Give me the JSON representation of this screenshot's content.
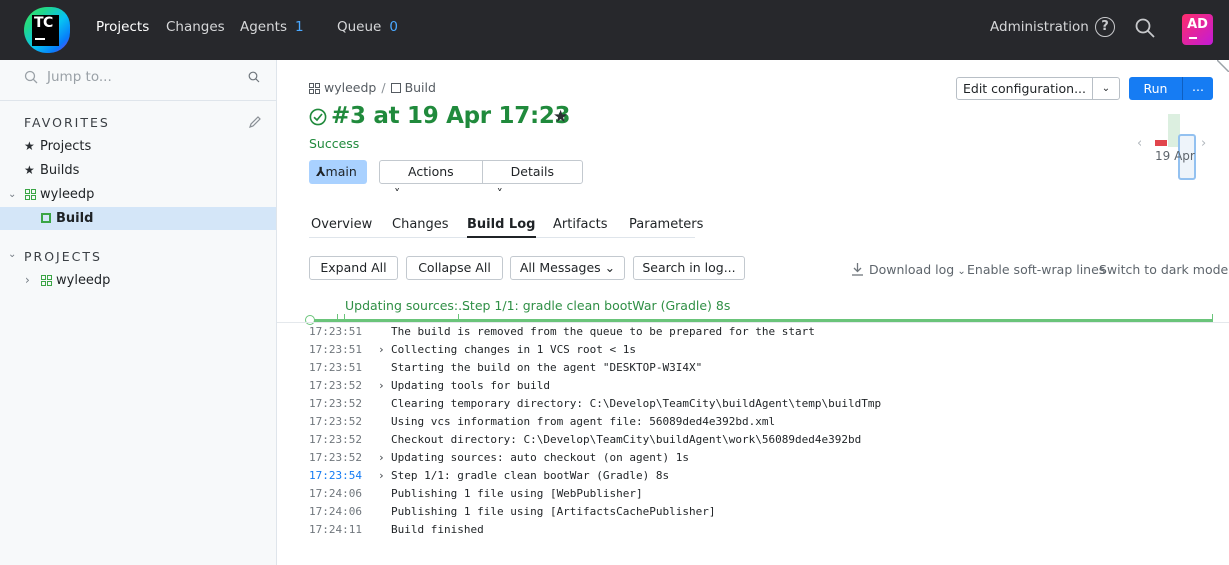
{
  "topbar": {
    "logo_text": "TC",
    "nav": [
      {
        "label": "Projects",
        "count": ""
      },
      {
        "label": "Changes",
        "count": ""
      },
      {
        "label": "Agents",
        "count": "1"
      },
      {
        "label": "Queue",
        "count": "0"
      }
    ],
    "admin": "Administration",
    "help": "?",
    "avatar": "AD"
  },
  "sidebar": {
    "search_placeholder": "Jump to...",
    "favorites_title": "FAVORITES",
    "favorites": [
      {
        "label": "Projects"
      },
      {
        "label": "Builds"
      },
      {
        "label": "wyleedp"
      },
      {
        "label": "Build"
      }
    ],
    "projects_title": "PROJECTS",
    "projects": [
      {
        "label": "wyleedp"
      }
    ]
  },
  "breadcrumb": {
    "project": "wyleedp",
    "sep": "/",
    "build_config": "Build"
  },
  "build": {
    "title": "#3 at 19 Apr 17:23",
    "status": "Success",
    "branch": "main",
    "actions_label": "Actions",
    "details_label": "Details"
  },
  "header_actions": {
    "edit_configuration": "Edit configuration...",
    "run": "Run",
    "run_more": "...",
    "history_date": "19 Apr"
  },
  "tabs": [
    "Overview",
    "Changes",
    "Build Log",
    "Artifacts",
    "Parameters"
  ],
  "active_tab": "Build Log",
  "log_toolbar": {
    "expand_all": "Expand All",
    "collapse_all": "Collapse All",
    "all_messages": "All Messages",
    "search_in_log": "Search in log...",
    "download_log": "Download log",
    "soft_wrap": "Enable soft-wrap lines",
    "dark_mode": "Switch to dark mode"
  },
  "timeline": {
    "step1": "Updating sources:...",
    "step2": "Step 1/1: gradle clean bootWar (Gradle) 8s"
  },
  "colors": {
    "accent": "#167cf3",
    "success": "#208a3c",
    "topbar": "#27282c"
  },
  "log": [
    {
      "time": "17:23:51",
      "expandable": false,
      "message": "The build is removed from the queue to be prepared for the start"
    },
    {
      "time": "17:23:51",
      "expandable": true,
      "message": "Collecting changes in 1 VCS root < 1s"
    },
    {
      "time": "17:23:51",
      "expandable": false,
      "message": "Starting the build on the agent \"DESKTOP-W3I4X\""
    },
    {
      "time": "17:23:52",
      "expandable": true,
      "message": "Updating tools for build"
    },
    {
      "time": "17:23:52",
      "expandable": false,
      "message": "Clearing temporary directory: C:\\Develop\\TeamCity\\buildAgent\\temp\\buildTmp"
    },
    {
      "time": "17:23:52",
      "expandable": false,
      "message": "Using vcs information from agent file: 56089ded4e392bd.xml"
    },
    {
      "time": "17:23:52",
      "expandable": false,
      "message": "Checkout directory: C:\\Develop\\TeamCity\\buildAgent\\work\\56089ded4e392bd"
    },
    {
      "time": "17:23:52",
      "expandable": true,
      "message": "Updating sources: auto checkout (on agent) 1s"
    },
    {
      "time": "17:23:54",
      "expandable": true,
      "highlight": true,
      "message": "Step 1/1: gradle clean bootWar (Gradle) 8s"
    },
    {
      "time": "17:24:06",
      "expandable": false,
      "message": "Publishing 1 file using [WebPublisher]"
    },
    {
      "time": "17:24:06",
      "expandable": false,
      "message": "Publishing 1 file using [ArtifactsCachePublisher]"
    },
    {
      "time": "17:24:11",
      "expandable": false,
      "message": "Build finished"
    }
  ]
}
